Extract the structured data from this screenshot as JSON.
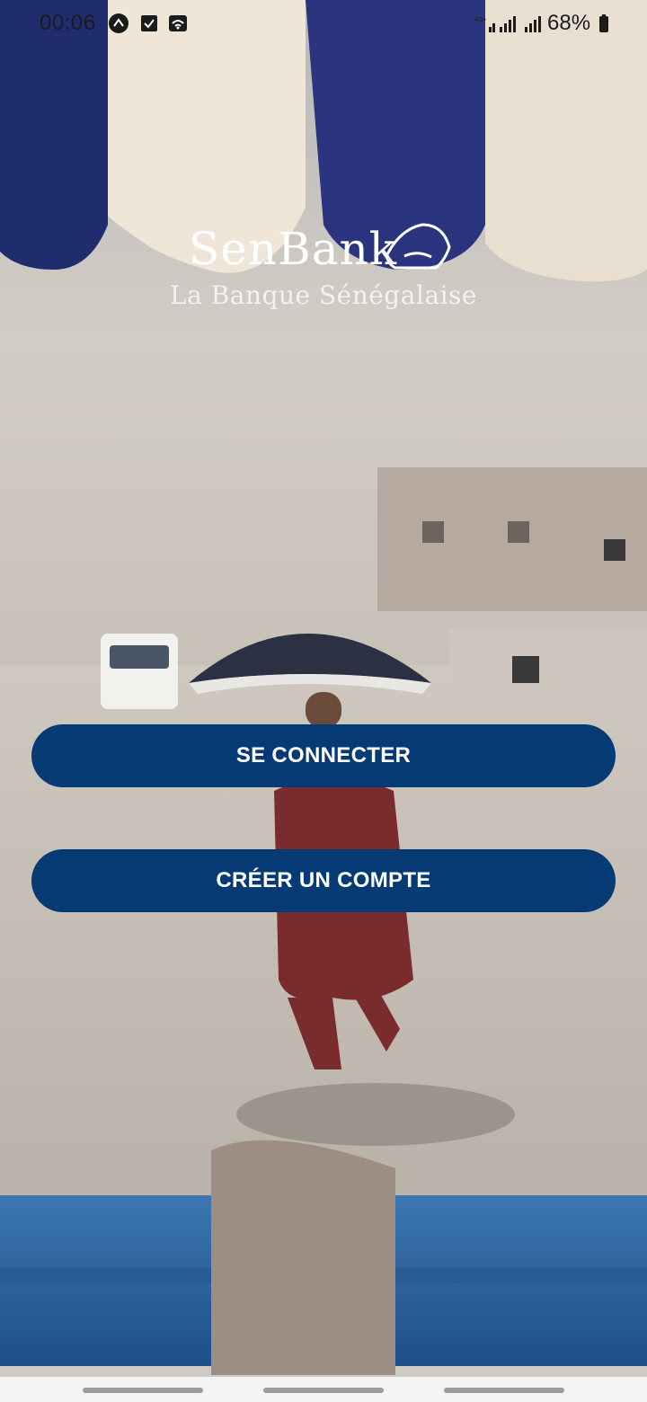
{
  "status": {
    "time": "00:06",
    "battery": "68%",
    "icons": [
      "app-icon",
      "check-box-icon",
      "wifi-icon",
      "signal-icon",
      "signal-icon",
      "battery-icon"
    ]
  },
  "brand": {
    "name": "SenBank",
    "tagline": "La Banque Sénégalaise",
    "logo_icon": "senegal-map-icon"
  },
  "actions": {
    "login": "SE CONNECTER",
    "create": "CRÉER UN COMPTE"
  },
  "theme": {
    "primary": "#063a75",
    "text_on_primary": "#ffffff"
  },
  "navigation": {
    "items": [
      "menu-bar",
      "home-bar",
      "back-bar"
    ]
  }
}
